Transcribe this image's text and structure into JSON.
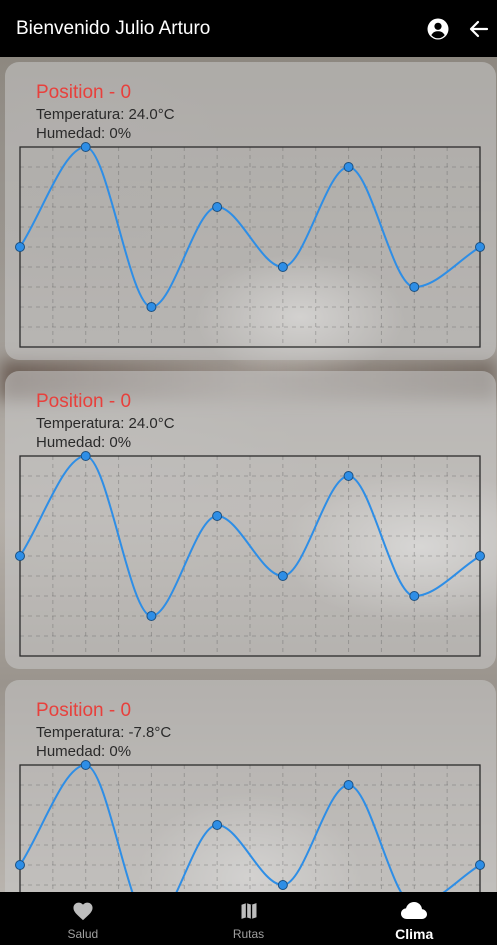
{
  "header": {
    "title": "Bienvenido Julio Arturo",
    "account_icon": "account-circle-icon",
    "back_icon": "arrow-left-icon"
  },
  "cards": [
    {
      "position": "Position - 0",
      "temp": "Temperatura: 24.0°C",
      "hum": "Humedad: 0%"
    },
    {
      "position": "Position - 0",
      "temp": "Temperatura: 24.0°C",
      "hum": "Humedad: 0%"
    },
    {
      "position": "Position - 0",
      "temp": "Temperatura: -7.8°C",
      "hum": "Humedad: 0%"
    }
  ],
  "chart_data": {
    "type": "line",
    "x": [
      0,
      1,
      2,
      3,
      4,
      5,
      6,
      7
    ],
    "values": [
      5,
      10,
      2,
      7,
      4,
      9,
      3,
      5
    ],
    "ylim": [
      0,
      10
    ],
    "grid": true,
    "line_color": "#2e8ee6",
    "point_color": "#2e8ee6",
    "smooth": true
  },
  "bottom_nav": {
    "items": [
      {
        "label": "Salud",
        "icon": "heart-icon",
        "active": false
      },
      {
        "label": "Rutas",
        "icon": "map-icon",
        "active": false
      },
      {
        "label": "Clima",
        "icon": "cloud-icon",
        "active": true
      }
    ]
  },
  "colors": {
    "position_text": "#e8403c",
    "nav_inactive": "#a0a0a0",
    "nav_active": "#ffffff"
  }
}
